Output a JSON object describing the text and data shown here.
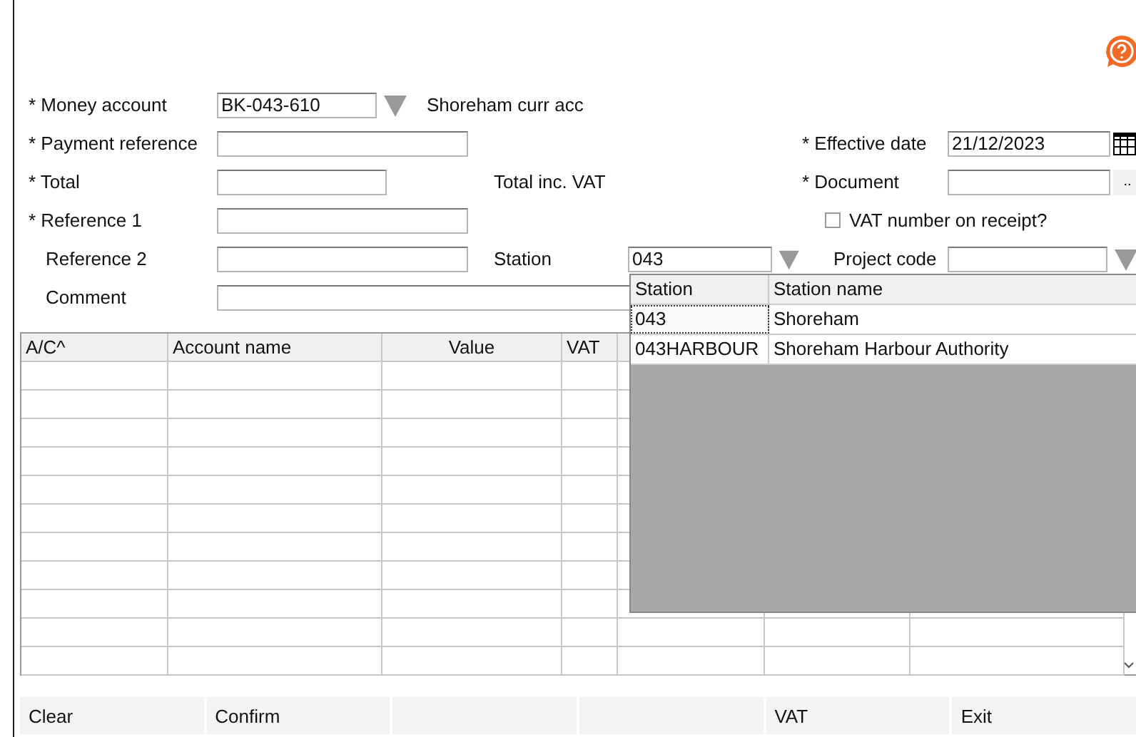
{
  "form": {
    "money_account": {
      "label": "* Money account",
      "value": "BK-043-610",
      "description": "Shoreham curr acc"
    },
    "payment_reference": {
      "label": "* Payment reference"
    },
    "total": {
      "label": "* Total",
      "note": "Total inc. VAT"
    },
    "reference_1": {
      "label": "* Reference 1"
    },
    "reference_2": {
      "label": "Reference 2"
    },
    "comment": {
      "label": "Comment"
    },
    "effective_date": {
      "label": "* Effective date",
      "value": "21/12/2023"
    },
    "document": {
      "label": "* Document",
      "browse": ".."
    },
    "vat_number_on_receipt": {
      "label": "VAT number on receipt?",
      "checked": false
    },
    "station": {
      "label": "Station",
      "value": "043"
    },
    "project_code": {
      "label": "Project code"
    }
  },
  "table": {
    "columns": [
      "A/C^",
      "Account name",
      "Value",
      "VAT"
    ]
  },
  "station_dropdown": {
    "columns": [
      "Station",
      "Station name"
    ],
    "rows": [
      {
        "code": "043",
        "name": "Shoreham",
        "selected": true
      },
      {
        "code": "043HARBOUR",
        "name": "Shoreham Harbour Authority",
        "selected": false
      }
    ]
  },
  "buttons": [
    {
      "kind": "text",
      "label": "Clear"
    },
    {
      "kind": "text",
      "label": "Confirm"
    },
    {
      "kind": "blank"
    },
    {
      "kind": "blank"
    },
    {
      "kind": "text",
      "label": "VAT"
    },
    {
      "kind": "text",
      "label": "Exit"
    }
  ]
}
